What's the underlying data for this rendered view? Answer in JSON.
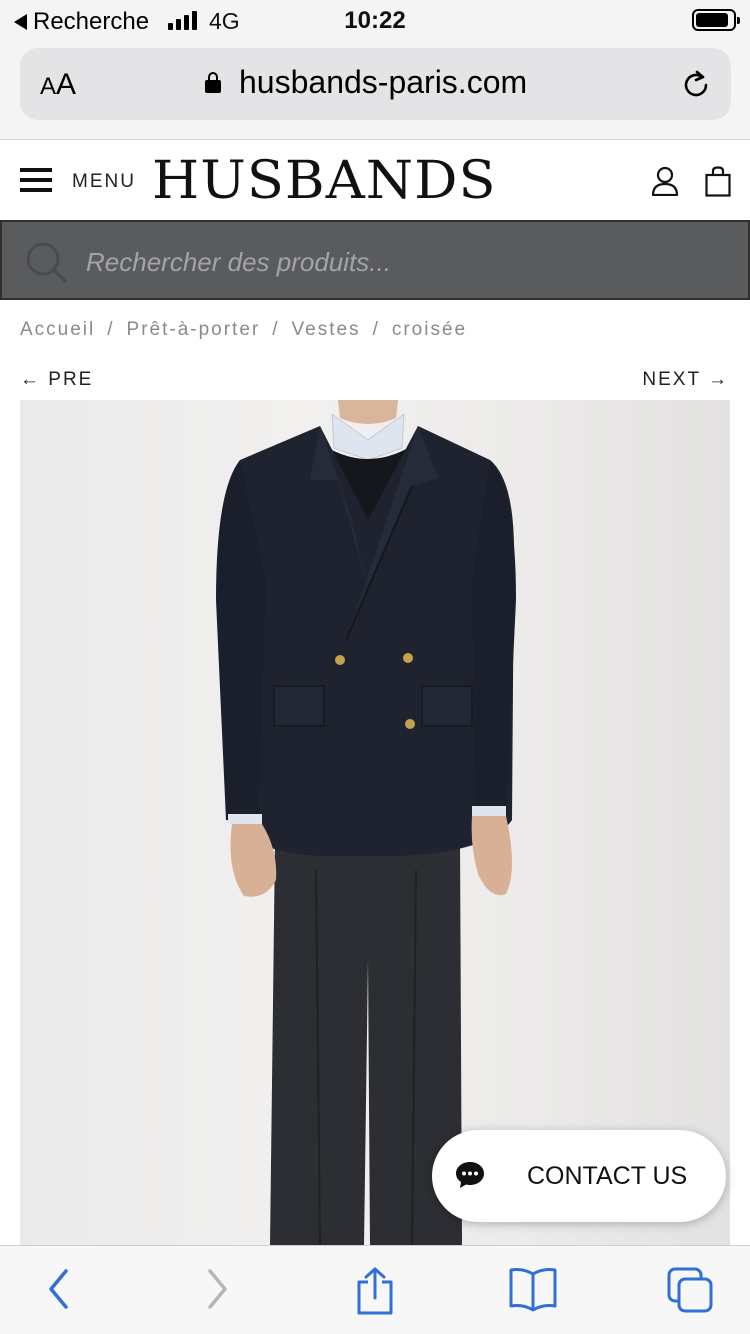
{
  "status": {
    "back_app": "Recherche",
    "network": "4G",
    "time": "10:22"
  },
  "browser": {
    "aa_small": "A",
    "aa_large": "A",
    "url": "husbands-paris.com"
  },
  "header": {
    "menu_label": "MENU",
    "logo": "HUSBANDS"
  },
  "search": {
    "placeholder": "Rechercher des produits..."
  },
  "breadcrumb": [
    "Accueil",
    "Prêt-à-porter",
    "Vestes",
    "croisée"
  ],
  "breadcrumb_sep": "/",
  "pager": {
    "prev": "← PRE",
    "next": "NEXT →"
  },
  "contact": {
    "label": "CONTACT US"
  },
  "colors": {
    "search_bg": "#5a5b5d",
    "accent_blue": "#2f6fd6",
    "jacket": "#1f2330"
  },
  "icons": [
    "back-triangle-icon",
    "signal-icon",
    "battery-icon",
    "lock-icon",
    "reload-icon",
    "hamburger-icon",
    "user-icon",
    "bag-icon",
    "search-icon",
    "chat-icon",
    "back-chevron-icon",
    "forward-chevron-icon",
    "share-icon",
    "bookmarks-icon",
    "tabs-icon"
  ]
}
